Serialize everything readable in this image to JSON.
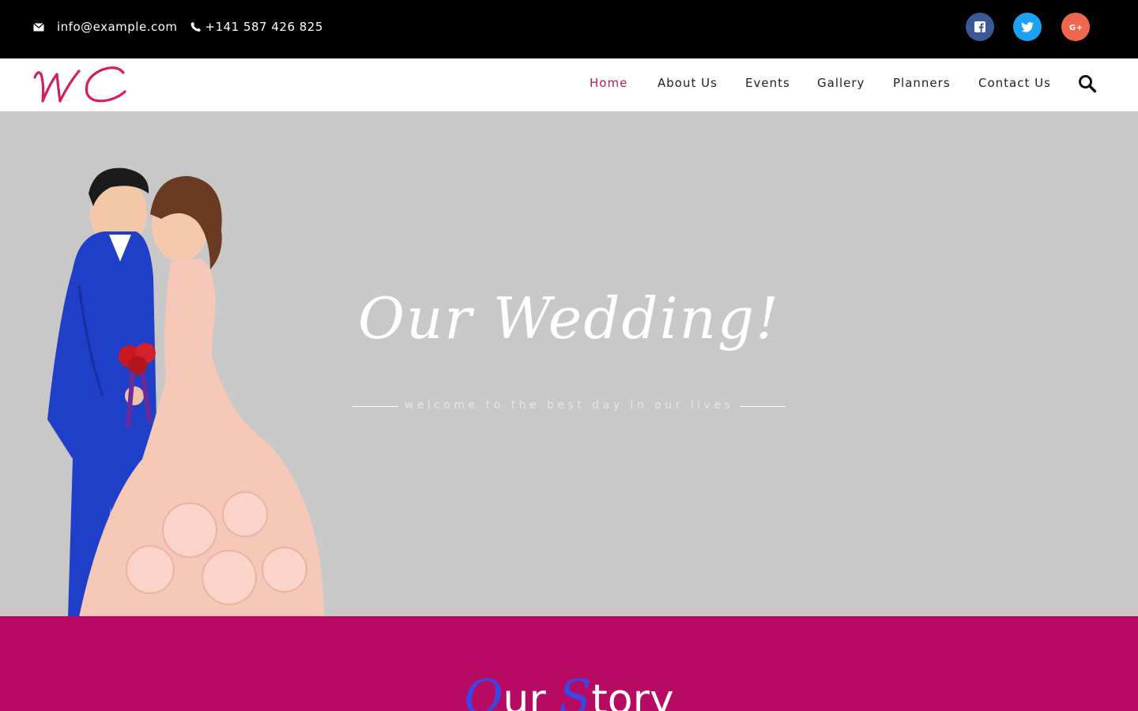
{
  "topbar": {
    "email": "info@example.com",
    "phone": "+141 587 426 825",
    "email_icon": "envelope-icon",
    "phone_icon": "phone-icon",
    "social": [
      {
        "name": "facebook",
        "color": "#3b5998"
      },
      {
        "name": "twitter",
        "color": "#1da1f2"
      },
      {
        "name": "google-plus",
        "color": "#f1674d"
      }
    ]
  },
  "logo": {
    "text": "WC",
    "color": "#d81b60"
  },
  "nav": {
    "items": [
      {
        "label": "Home",
        "active": true
      },
      {
        "label": "About Us",
        "active": false
      },
      {
        "label": "Events",
        "active": false
      },
      {
        "label": "Gallery",
        "active": false
      },
      {
        "label": "Planners",
        "active": false
      },
      {
        "label": "Contact Us",
        "active": false
      }
    ],
    "active_color": "#c2185b",
    "search_icon": "search-icon"
  },
  "hero": {
    "title": "Our Wedding!",
    "subtitle": "welcome to the best day in our lives",
    "background": "#c8c8c8"
  },
  "story": {
    "title_initial_1": "O",
    "title_rest_1": "ur",
    "title_initial_2": "S",
    "title_rest_2": "tory",
    "background": "#b70a63",
    "initial_color": "#3a48e8"
  }
}
